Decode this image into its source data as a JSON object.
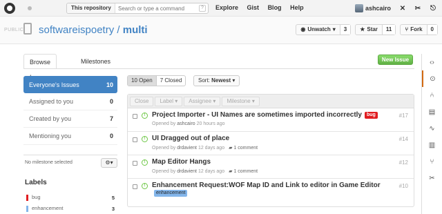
{
  "header": {
    "search_scope": "This repository",
    "search_placeholder": "Search or type a command",
    "search_hint": "?",
    "nav": [
      "Explore",
      "Gist",
      "Blog",
      "Help"
    ],
    "username": "ashcairo"
  },
  "repo": {
    "visibility": "PUBLIC",
    "owner": "softwareispoetry",
    "separator": "/",
    "name": "multi",
    "watch_label": "Unwatch",
    "watch_count": "3",
    "star_label": "Star",
    "star_count": "11",
    "fork_label": "Fork",
    "fork_count": "0"
  },
  "tabs": [
    {
      "label": "Browse Issues",
      "selected": true
    },
    {
      "label": "Milestones",
      "selected": false
    }
  ],
  "new_issue_label": "New Issue",
  "filters": [
    {
      "label": "Everyone's Issues",
      "count": "10",
      "active": true
    },
    {
      "label": "Assigned to you",
      "count": "0",
      "active": false
    },
    {
      "label": "Created by you",
      "count": "7",
      "active": false
    },
    {
      "label": "Mentioning you",
      "count": "0",
      "active": false
    }
  ],
  "milestone_text": "No milestone selected",
  "labels_heading": "Labels",
  "labels": [
    {
      "name": "bug",
      "count": "5",
      "color": "#e11d21"
    },
    {
      "name": "enhancement",
      "count": "3",
      "color": "#84b6eb"
    }
  ],
  "state_toggle": {
    "open": "10 Open",
    "closed": "7 Closed"
  },
  "sort": {
    "prefix": "Sort:",
    "value": "Newest"
  },
  "tools": [
    "Close",
    "Label",
    "Assignee",
    "Milestone"
  ],
  "issues": [
    {
      "title": "Project Importer - UI Names are sometimes imported incorrectly",
      "label": "bug",
      "label_color": "#e11d21",
      "opened": "Opened by",
      "author": "ashcairo",
      "age": "20 hours ago",
      "comments": "",
      "number": "#17"
    },
    {
      "title": "UI Dragged out of place",
      "label": "",
      "label_color": "",
      "opened": "Opened by",
      "author": "drdavient",
      "age": "12 days ago",
      "comments": "1 comment",
      "number": "#14"
    },
    {
      "title": "Map Editor Hangs",
      "label": "",
      "label_color": "",
      "opened": "Opened by",
      "author": "drdavient",
      "age": "12 days ago",
      "comments": "1 comment",
      "number": "#12"
    },
    {
      "title": "Enhancement Request:WOF Map ID and Link to editor in Game Editor",
      "label": "enhancement",
      "label_color": "#84b6eb",
      "opened": "",
      "author": "",
      "age": "",
      "comments": "",
      "number": "#10"
    }
  ],
  "colors": {
    "accent": "#4183c4",
    "new_issue_green": "#60b044",
    "open_icon": "#6cc644"
  }
}
